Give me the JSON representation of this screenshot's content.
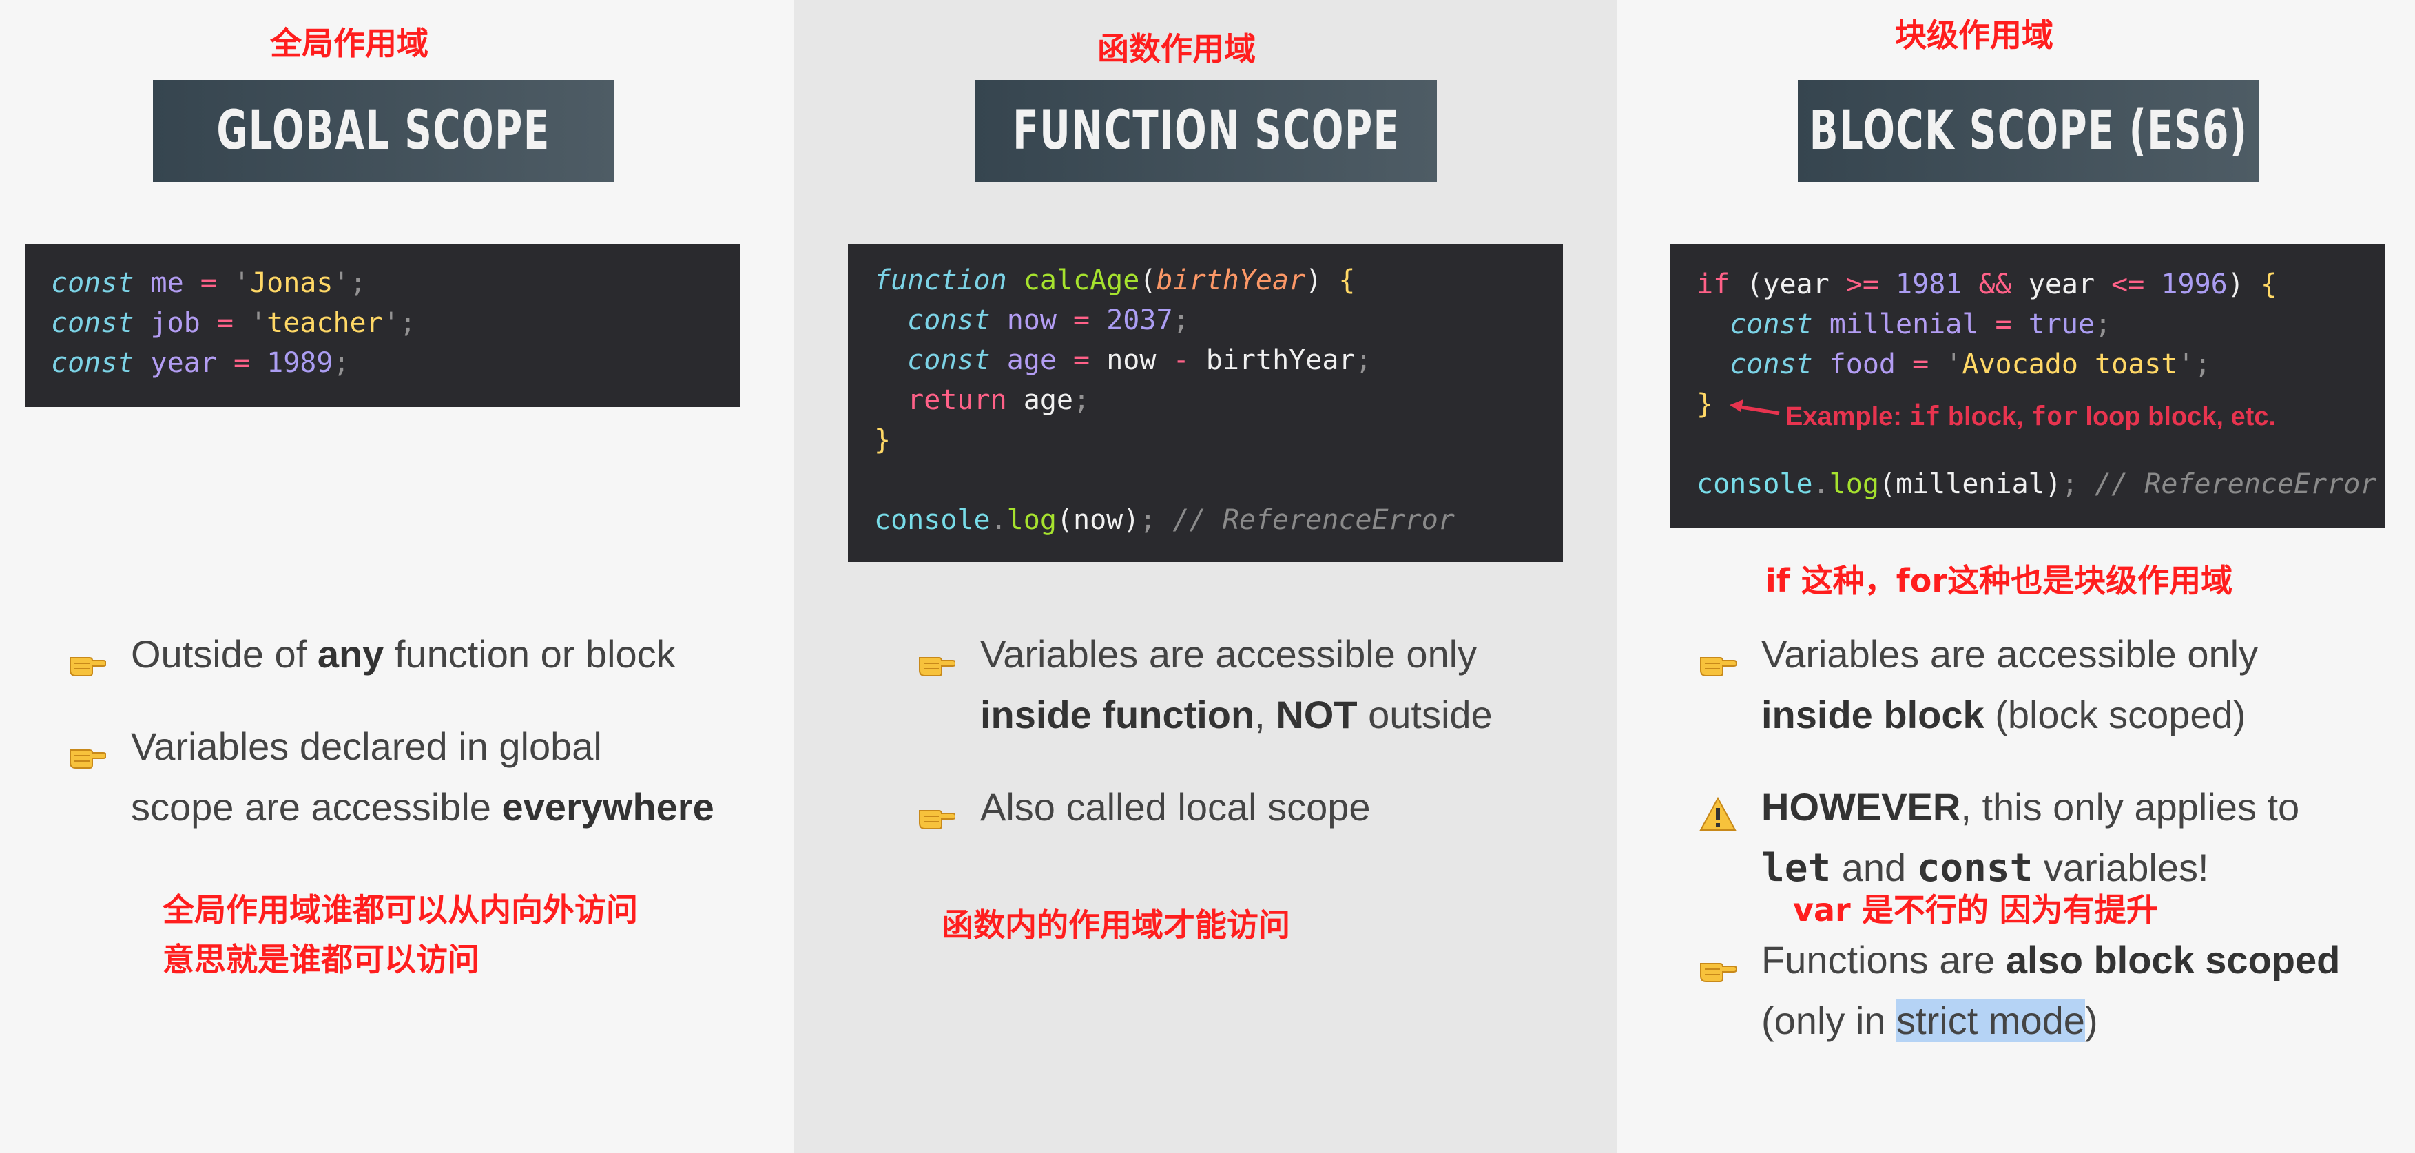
{
  "col1": {
    "note_title": "全局作用域",
    "banner": "GLOBAL SCOPE",
    "code": {
      "l1": {
        "k": "const",
        "v": "me",
        "o": "=",
        "q1": "'",
        "s": "Jonas",
        "q2": "'",
        "e": ";"
      },
      "l2": {
        "k": "const",
        "v": "job",
        "o": "=",
        "q1": "'",
        "s": "teacher",
        "q2": "'",
        "e": ";"
      },
      "l3": {
        "k": "const",
        "v": "year",
        "o": "=",
        "n": "1989",
        "e": ";"
      }
    },
    "b1": {
      "pre": "Outside of ",
      "bold": "any",
      "post": " function or block"
    },
    "b2": {
      "l1": "Variables declared in global",
      "l2_pre": "scope are accessible ",
      "l2_bold": "everywhere"
    },
    "note1": "全局作用域谁都可以从内向外访问",
    "note2": "意思就是谁都可以访问"
  },
  "col2": {
    "note_title": "函数作用域",
    "banner": "FUNCTION SCOPE",
    "code": {
      "kw_function": "function",
      "fname": "calcAge",
      "lp": "(",
      "param": "birthYear",
      "rp": ")",
      "lb": "{",
      "kw_const": "const",
      "now": "now",
      "eq": "=",
      "n2037": "2037",
      "semi": ";",
      "age": "age",
      "minus": "-",
      "birthYear": "birthYear",
      "ret": "return",
      "rb": "}",
      "console": "console",
      "dot": ".",
      "log": "log",
      "comment": "// ReferenceError"
    },
    "b1": {
      "l1": "Variables are accessible only",
      "l2_b1": "inside function",
      "l2_mid": ", ",
      "l2_b2": "NOT",
      "l2_post": " outside"
    },
    "b2": "Also called local scope",
    "note": "函数内的作用域才能访问"
  },
  "col3": {
    "note_title": "块级作用域",
    "banner": "BLOCK SCOPE (ES6)",
    "code": {
      "kw_if": "if",
      "lp": "(",
      "year": "year",
      "ge": ">=",
      "n1981": "1981",
      "and": "&&",
      "le": "<=",
      "n1996": "1996",
      "rp": ")",
      "lb": "{",
      "kw_const": "const",
      "millenial": "millenial",
      "eq": "=",
      "true": "true",
      "semi": ";",
      "food": "food",
      "q": "'",
      "avocado": "Avocado toast",
      "rb": "}",
      "console": "console",
      "dot": ".",
      "log": "log",
      "comment": "// ReferenceError"
    },
    "arrow_note": {
      "pre": "Example: ",
      "m1": "if",
      "mid1": " block, ",
      "m2": "for",
      "post": " loop block, etc."
    },
    "note_if": "if 这种，for这种也是块级作用域",
    "b1": {
      "l1": "Variables are accessible only",
      "l2_b": "inside block",
      "l2_post": " (block scoped)"
    },
    "b2": {
      "l1_b": "HOWEVER",
      "l1_post": ", this only applies to",
      "l2_m1": "let",
      "l2_mid": " and ",
      "l2_m2": "const",
      "l2_post": " variables!"
    },
    "note_var": "var 是不行的 因为有提升",
    "b3": {
      "l1_pre": "Functions are ",
      "l1_b": "also block scoped",
      "l2_pre": "(only in ",
      "l2_hl": "strict mode",
      "l2_post": ")"
    }
  },
  "colors": {
    "annotation_red": "#ff1e1e",
    "banner": "#3d4b54",
    "code_bg": "#2a2a2e",
    "highlight": "#b5d3f5"
  },
  "icons": {
    "pointing": "pointing-hand-icon",
    "warning": "warning-icon",
    "arrow": "red-arrow-icon"
  }
}
